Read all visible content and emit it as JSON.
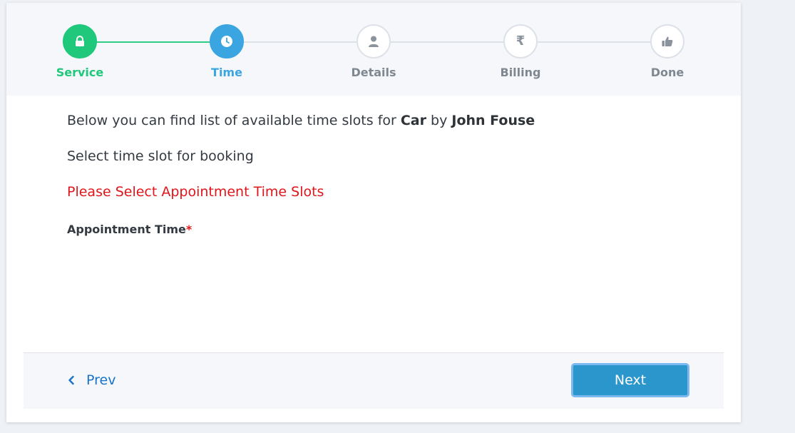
{
  "stepper": {
    "steps": [
      {
        "label": "Service",
        "icon": "lock-icon",
        "state": "completed"
      },
      {
        "label": "Time",
        "icon": "clock-icon",
        "state": "active"
      },
      {
        "label": "Details",
        "icon": "user-icon",
        "state": "pending"
      },
      {
        "label": "Billing",
        "icon": "rupee-icon",
        "state": "pending",
        "glyph": "₹"
      },
      {
        "label": "Done",
        "icon": "thumbs-up-icon",
        "state": "pending"
      }
    ]
  },
  "content": {
    "intro_prefix": "Below you can find list of available time slots for ",
    "service_name": "Car",
    "intro_by": " by ",
    "provider_name": "John Fouse",
    "instruction": "Select time slot for booking",
    "error_message": "Please Select Appointment Time Slots",
    "field_label": "Appointment Time",
    "required_marker": "*"
  },
  "footer": {
    "prev_label": "Prev",
    "next_label": "Next"
  },
  "colors": {
    "completed": "#1fc87a",
    "active": "#3aa5e0",
    "pending": "#7f8791",
    "error": "#e0151a",
    "link": "#1a73c9",
    "button": "#2a96cc"
  }
}
